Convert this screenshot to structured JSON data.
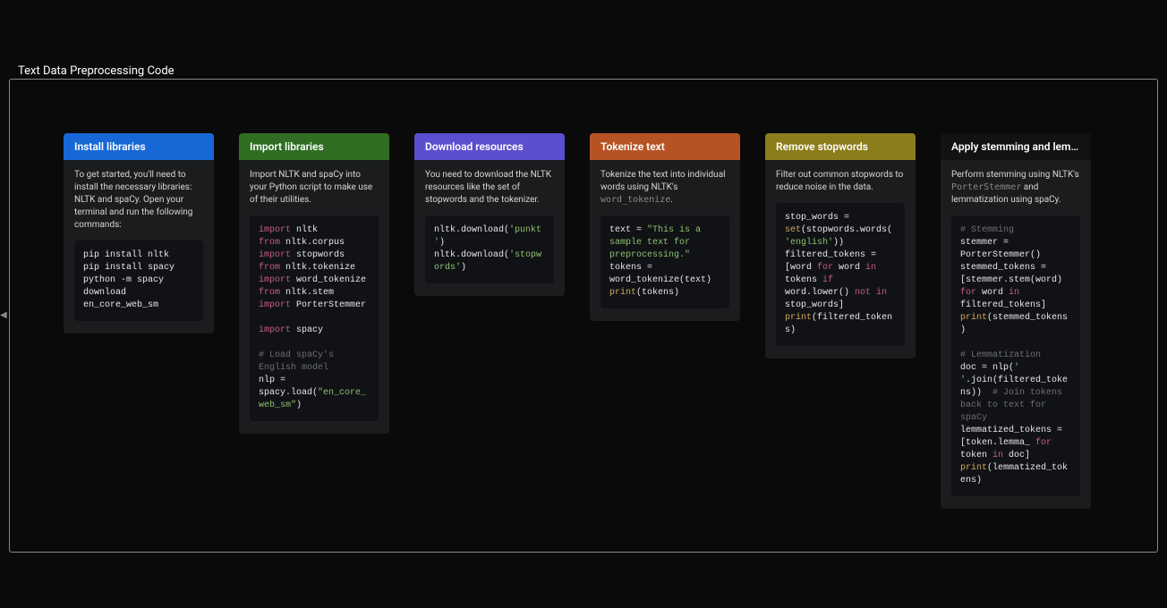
{
  "title": "Text Data Preprocessing Code",
  "cards": [
    {
      "header": "Install libraries",
      "headerColor": "blue",
      "desc": "To get started, you'll need to install the necessary libraries: NLTK and spaCy. Open your terminal and run the following commands:",
      "code_plain": "pip install nltk\npip install spacy\npython -m spacy download en_core_web_sm"
    },
    {
      "header": "Import libraries",
      "headerColor": "green",
      "desc": "Import NLTK and spaCy into your Python script to make use of their utilities."
    },
    {
      "header": "Download resources",
      "headerColor": "purple",
      "desc": "You need to download the NLTK resources like the set of stopwords and the tokenizer."
    },
    {
      "header": "Tokenize text",
      "headerColor": "orange",
      "desc_prefix": "Tokenize the text into individual words using NLTK's ",
      "desc_code": "word_tokenize",
      "desc_suffix": "."
    },
    {
      "header": "Remove stopwords",
      "headerColor": "olive",
      "desc": "Filter out common stopwords to reduce noise in the data."
    },
    {
      "header": "Apply stemming and lemmatization",
      "headerColor": "dark",
      "desc_prefix": "Perform stemming using NLTK's ",
      "desc_code": "PorterStemmer",
      "desc_suffix": " and lemmatization using spaCy."
    }
  ],
  "code": {
    "import_libs": {
      "l1a": "import",
      "l1b": " nltk",
      "l2a": "from",
      "l2b": " nltk.corpus ",
      "l2c": "import",
      "l2d": " stopwords",
      "l3a": "from",
      "l3b": " nltk.tokenize ",
      "l3c": "import",
      "l3d": " word_tokenize",
      "l4a": "from",
      "l4b": " nltk.stem ",
      "l4c": "import",
      "l4d": " PorterStemmer",
      "l5a": "import",
      "l5b": " spacy",
      "l6": "# Load spaCy's English model",
      "l7a": "nlp = spacy.load(",
      "l7b": "\"en_core_web_sm\"",
      "l7c": ")"
    },
    "download": {
      "l1a": "nltk.download(",
      "l1b": "'punkt'",
      "l1c": ")",
      "l2a": "nltk.download(",
      "l2b": "'stopwords'",
      "l2c": ")"
    },
    "tokenize": {
      "l1a": "text = ",
      "l1b": "\"This is a sample text for preprocessing.\"",
      "l2": "tokens = word_tokenize(text)",
      "l3a": "print",
      "l3b": "(tokens)"
    },
    "stopwords": {
      "l1a": "stop_words = ",
      "l1b": "set",
      "l1c": "(stopwords.words(",
      "l1d": "'english'",
      "l1e": "))",
      "l2a": "filtered_tokens = [word ",
      "l2b": "for",
      "l2c": " word ",
      "l2d": "in",
      "l2e": " tokens ",
      "l2f": "if",
      "l2g": " word.lower() ",
      "l2h": "not",
      "l2i": " ",
      "l2j": "in",
      "l2k": " stop_words]",
      "l3a": "print",
      "l3b": "(filtered_tokens)"
    },
    "stemlemma": {
      "c1": "# Stemming",
      "l1": "stemmer = PorterStemmer()",
      "l2a": "stemmed_tokens = [stemmer.stem(word) ",
      "l2b": "for",
      "l2c": " word ",
      "l2d": "in",
      "l2e": " filtered_tokens]",
      "l3a": "print",
      "l3b": "(stemmed_tokens)",
      "c2": "# Lemmatization",
      "l4a": "doc = nlp(",
      "l4b": "' '",
      "l4c": ".join(filtered_tokens))  ",
      "c3": "# Join tokens back to text for spaCy",
      "l5a": "lemmatized_tokens = [token.lemma_ ",
      "l5b": "for",
      "l5c": " token ",
      "l5d": "in",
      "l5e": " doc]",
      "l6a": "print",
      "l6b": "(lemmatized_tokens)"
    }
  }
}
